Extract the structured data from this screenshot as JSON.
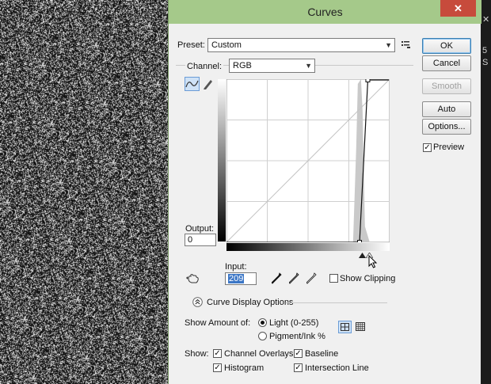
{
  "dialog": {
    "title": "Curves",
    "close_glyph": "✕",
    "preset_label": "Preset:",
    "preset_value": "Custom",
    "channel_label": "Channel:",
    "channel_value": "RGB",
    "output_label": "Output:",
    "output_value": "0",
    "input_label": "Input:",
    "input_value": "209",
    "show_clipping_label": "Show Clipping",
    "show_clipping_checked": false,
    "curve_display_options_label": "Curve Display Options",
    "show_amount_label": "Show Amount of:",
    "light_label": "Light  (0-255)",
    "pigment_label": "Pigment/Ink %",
    "show_label": "Show:",
    "channel_overlays_label": "Channel Overlays",
    "baseline_label": "Baseline",
    "histogram_label": "Histogram",
    "intersection_line_label": "Intersection Line"
  },
  "buttons": {
    "ok": "OK",
    "cancel": "Cancel",
    "smooth": "Smooth",
    "auto": "Auto",
    "options": "Options...",
    "preview": "Preview"
  },
  "checks": {
    "preview": true,
    "channel_overlays": true,
    "baseline": true,
    "histogram": true,
    "intersection_line": true
  },
  "curve": {
    "points": [
      [
        0,
        0
      ],
      [
        209,
        0
      ],
      [
        222,
        255
      ],
      [
        255,
        255
      ]
    ],
    "histogram_peak_input": 210
  },
  "colors": {
    "titlebar": "#a5c98a",
    "close": "#c74b3c",
    "selection": "#3b76c6"
  },
  "icons": [
    "curve-tool-icon",
    "pencil-tool-icon",
    "target-hand-icon",
    "black-eyedropper-icon",
    "gray-eyedropper-icon",
    "white-eyedropper-icon",
    "preset-menu-icon",
    "chevron-up-circle-icon",
    "simple-grid-icon",
    "detailed-grid-icon"
  ]
}
